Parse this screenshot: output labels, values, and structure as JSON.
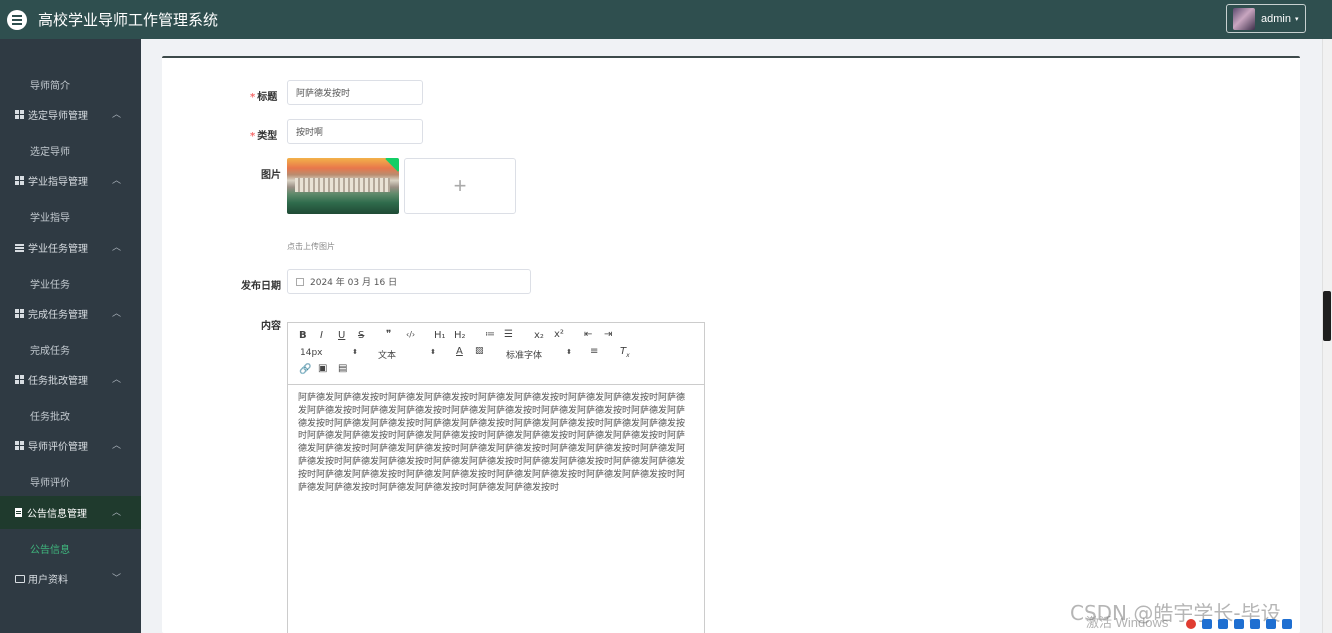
{
  "header": {
    "app_title": "高校学业导师工作管理系统",
    "username": "admin",
    "caret": "▾"
  },
  "sidebar": {
    "items": [
      {
        "kind": "sub",
        "label": "导师简介"
      },
      {
        "kind": "group",
        "label": "选定导师管理",
        "icon": "grid-icon",
        "expanded": true
      },
      {
        "kind": "sub",
        "label": "选定导师"
      },
      {
        "kind": "group",
        "label": "学业指导管理",
        "icon": "grid-icon",
        "expanded": true
      },
      {
        "kind": "sub",
        "label": "学业指导"
      },
      {
        "kind": "group",
        "label": "学业任务管理",
        "icon": "list-icon",
        "expanded": true
      },
      {
        "kind": "sub",
        "label": "学业任务"
      },
      {
        "kind": "group",
        "label": "完成任务管理",
        "icon": "grid-icon",
        "expanded": true
      },
      {
        "kind": "sub",
        "label": "完成任务"
      },
      {
        "kind": "group",
        "label": "任务批改管理",
        "icon": "grid-icon",
        "expanded": true
      },
      {
        "kind": "sub",
        "label": "任务批改"
      },
      {
        "kind": "group",
        "label": "导师评价管理",
        "icon": "grid-icon",
        "expanded": true
      },
      {
        "kind": "sub",
        "label": "导师评价"
      },
      {
        "kind": "group",
        "label": "公告信息管理",
        "icon": "document-icon",
        "expanded": true,
        "active": true
      },
      {
        "kind": "sub",
        "label": "公告信息",
        "active": true
      },
      {
        "kind": "group",
        "label": "用户资料",
        "icon": "box-icon",
        "expanded": false
      }
    ],
    "chevron_up": "︿",
    "chevron_down": "﹀"
  },
  "form": {
    "title_label": "标题",
    "title_value": "阿萨德发按时",
    "type_label": "类型",
    "type_value": "按时啊",
    "image_label": "图片",
    "upload_plus": "+",
    "upload_hint": "点击上传图片",
    "date_label": "发布日期",
    "date_value": "2024 年 03 月 16 日",
    "content_label": "内容",
    "required_mark": "*"
  },
  "editor": {
    "toolbar_row1": [
      "B",
      "I",
      "U",
      "S",
      "❞",
      "‹/›",
      "H₁",
      "H₂",
      "≔",
      "☰",
      "x₂",
      "x²",
      "⇤",
      "⇥"
    ],
    "font_size": "14px",
    "text_type": "文本",
    "font_family": "标准字体",
    "picker_arrow": "⬍",
    "content": "阿萨德发阿萨德发按时阿萨德发阿萨德发按时阿萨德发阿萨德发按时阿萨德发阿萨德发按时阿萨德发阿萨德发按时阿萨德发阿萨德发按时阿萨德发阿萨德发按时阿萨德发阿萨德发按时阿萨德发阿萨德发按时阿萨德发阿萨德发按时阿萨德发阿萨德发按时阿萨德发阿萨德发按时阿萨德发阿萨德发按时阿萨德发阿萨德发按时阿萨德发阿萨德发按时阿萨德发阿萨德发按时阿萨德发阿萨德发按时阿萨德发阿萨德发按时阿萨德发阿萨德发按时阿萨德发阿萨德发按时阿萨德发阿萨德发按时阿萨德发阿萨德发按时阿萨德发阿萨德发按时阿萨德发阿萨德发按时阿萨德发阿萨德发按时阿萨德发阿萨德发按时阿萨德发阿萨德发按时阿萨德发阿萨德发按时阿萨德发阿萨德发按时阿萨德发阿萨德发按时阿萨德发阿萨德发按时阿萨德发阿萨德发按时阿萨德发阿萨德发按时"
  },
  "overlay": {
    "watermark": "CSDN @皓宇学长-毕设",
    "activate": "激活 Windows"
  },
  "colors": {
    "header_bg": "#2f4f4f",
    "sidebar_bg": "#2f3a43",
    "active_group_bg": "#1f3a2d",
    "active_text": "#3fb77e",
    "required": "#f56c6c"
  }
}
